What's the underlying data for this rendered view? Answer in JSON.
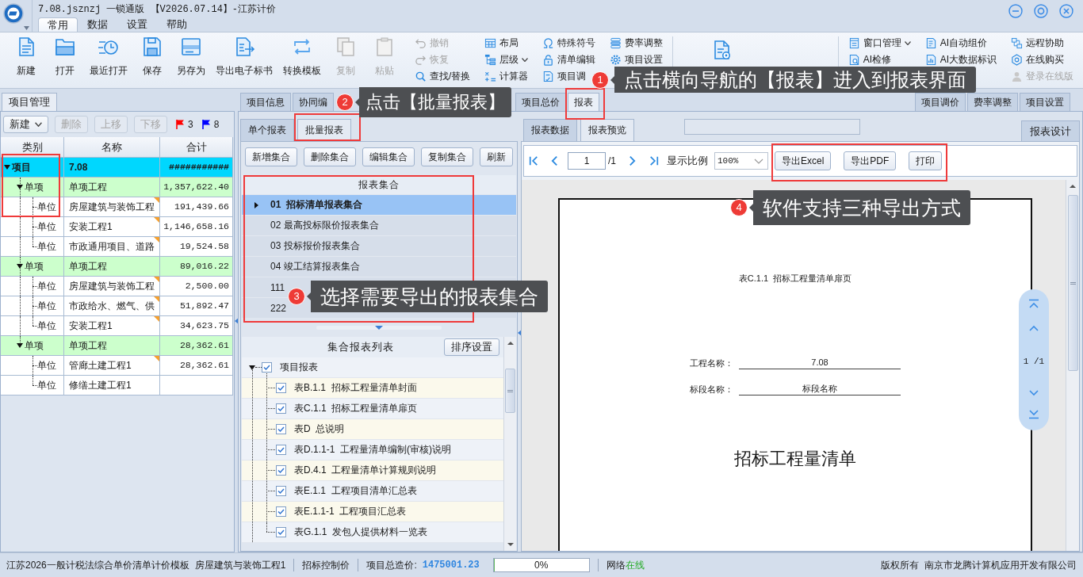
{
  "window": {
    "title": "7.08.jsznzj 一锁通版 【V2026.07.14】-江苏计价"
  },
  "menu_tabs": [
    {
      "label": "常用",
      "selected": true
    },
    {
      "label": "数据",
      "selected": false
    },
    {
      "label": "设置",
      "selected": false
    },
    {
      "label": "帮助",
      "selected": false
    }
  ],
  "toolbar": {
    "large_buttons": [
      {
        "label": "新建",
        "disabled": false
      },
      {
        "label": "打开",
        "disabled": false
      },
      {
        "label": "最近打开",
        "disabled": false
      },
      {
        "label": "保存",
        "disabled": false
      },
      {
        "label": "另存为",
        "disabled": false
      },
      {
        "label": "导出电子标书",
        "disabled": false
      },
      {
        "label": "转换模板",
        "disabled": false
      },
      {
        "label": "复制",
        "disabled": true
      },
      {
        "label": "粘贴",
        "disabled": true
      }
    ],
    "small_columns": [
      [
        {
          "label": "撤销",
          "kind": "button",
          "disabled": true
        },
        {
          "label": "恢复",
          "kind": "button",
          "disabled": true
        },
        {
          "label": "查找/替换",
          "kind": "button",
          "disabled": false
        }
      ],
      [
        {
          "label": "布局",
          "kind": "button",
          "disabled": false
        },
        {
          "label": "层级",
          "kind": "dropdown",
          "disabled": false
        },
        {
          "label": "计算器",
          "kind": "button",
          "disabled": false
        }
      ],
      [
        {
          "label": "特殊符号",
          "kind": "button",
          "disabled": false
        },
        {
          "label": "清单编辑",
          "kind": "button",
          "disabled": false
        },
        {
          "label": "项目调",
          "kind": "button",
          "disabled": false
        }
      ],
      [
        {
          "label": "费率调整",
          "kind": "button",
          "disabled": false
        },
        {
          "label": "项目设置",
          "kind": "button",
          "disabled": false
        }
      ]
    ],
    "right_columns": [
      [
        {
          "label": "窗口管理",
          "kind": "dropdown",
          "disabled": false
        },
        {
          "label": "AI检修",
          "kind": "button",
          "disabled": false
        }
      ],
      [
        {
          "label": "AI自动组价",
          "kind": "button",
          "disabled": false
        },
        {
          "label": "AI大数据标识",
          "kind": "button",
          "disabled": false
        }
      ],
      [
        {
          "label": "远程协助",
          "kind": "button",
          "disabled": false
        },
        {
          "label": "在线购买",
          "kind": "button",
          "disabled": false
        },
        {
          "label": "登录在线版",
          "kind": "button",
          "disabled": true
        }
      ]
    ]
  },
  "project_panel": {
    "tab": "项目管理",
    "actions": [
      {
        "label": "新建",
        "kind": "dropdown",
        "disabled": false
      },
      {
        "label": "删除",
        "kind": "button",
        "disabled": true
      },
      {
        "label": "上移",
        "kind": "button",
        "disabled": true
      },
      {
        "label": "下移",
        "kind": "button",
        "disabled": true
      }
    ],
    "flags": [
      {
        "count": "3",
        "color": "#ff0000"
      },
      {
        "count": "8",
        "color": "#0000ff"
      }
    ],
    "columns": [
      "类别",
      "名称",
      "合计"
    ],
    "tree": [
      {
        "category": "项目",
        "name": "7.08",
        "total": "###########",
        "kind": "project",
        "expanded": true,
        "marked": false,
        "children": [
          {
            "category": "单项",
            "name": "单项工程",
            "total": "1,357,622.40",
            "kind": "group",
            "expanded": true,
            "marked": false,
            "children": [
              {
                "category": "单位",
                "name": "房屋建筑与装饰工程",
                "total": "191,439.66",
                "kind": "unit",
                "marked": true
              },
              {
                "category": "单位",
                "name": "安装工程1",
                "total": "1,146,658.16",
                "kind": "unit",
                "marked": true
              },
              {
                "category": "单位",
                "name": "市政通用项目、道路",
                "total": "19,524.58",
                "kind": "unit",
                "marked": true
              }
            ]
          },
          {
            "category": "单项",
            "name": "单项工程",
            "total": "89,016.22",
            "kind": "group",
            "expanded": true,
            "marked": false,
            "children": [
              {
                "category": "单位",
                "name": "房屋建筑与装饰工程",
                "total": "2,500.00",
                "kind": "unit",
                "marked": true
              },
              {
                "category": "单位",
                "name": "市政给水、燃气、供",
                "total": "51,892.47",
                "kind": "unit",
                "marked": true
              },
              {
                "category": "单位",
                "name": "安装工程1",
                "total": "34,623.75",
                "kind": "unit",
                "marked": true
              }
            ]
          },
          {
            "category": "单项",
            "name": "单项工程",
            "total": "28,362.61",
            "kind": "group",
            "expanded": true,
            "marked": false,
            "children": [
              {
                "category": "单位",
                "name": "管廊土建工程1",
                "total": "28,362.61",
                "kind": "unit",
                "marked": true
              },
              {
                "category": "单位",
                "name": "修缮土建工程1",
                "kind": "unit",
                "marked": false
              }
            ]
          }
        ]
      }
    ]
  },
  "main_tabs": {
    "left": [
      {
        "label": "项目信息",
        "selected": false
      },
      {
        "label": "协同编",
        "selected": false
      },
      {
        "label": "项目总价",
        "selected": false
      },
      {
        "label": "报表",
        "selected": true
      }
    ],
    "right": [
      {
        "label": "项目调价",
        "selected": false
      },
      {
        "label": "费率调整",
        "selected": false
      },
      {
        "label": "项目设置",
        "selected": false
      }
    ]
  },
  "report_panel": {
    "sub_tabs": [
      {
        "label": "单个报表",
        "selected": false
      },
      {
        "label": "批量报表",
        "selected": true
      }
    ],
    "actions": [
      "新增集合",
      "删除集合",
      "编辑集合",
      "复制集合",
      "刷新"
    ],
    "collections": {
      "header": "报表集合",
      "rows": [
        {
          "label": "01  招标清单报表集合",
          "selected": true
        },
        {
          "label": "02 最高投标限价报表集合",
          "selected": false
        },
        {
          "label": "03 投标报价报表集合",
          "selected": false
        },
        {
          "label": "04 竣工结算报表集合",
          "selected": false
        },
        {
          "label": "111",
          "selected": false
        },
        {
          "label": "222",
          "selected": false
        }
      ]
    },
    "report_list": {
      "header": "集合报表列表",
      "sort_button": "排序设置",
      "tree": {
        "label": "项目报表",
        "checked": true,
        "expanded": true,
        "children": [
          {
            "label": "表B.1.1  招标工程量清单封面",
            "checked": true
          },
          {
            "label": "表C.1.1  招标工程量清单扉页",
            "checked": true
          },
          {
            "label": "表D  总说明",
            "checked": true
          },
          {
            "label": "表D.1.1-1  工程量清单编制(审核)说明",
            "checked": true
          },
          {
            "label": "表D.4.1  工程量清单计算规则说明",
            "checked": true
          },
          {
            "label": "表E.1.1  工程项目清单汇总表",
            "checked": true
          },
          {
            "label": "表E.1.1-1  工程项目汇总表",
            "checked": true
          },
          {
            "label": "表G.1.1  发包人提供材料一览表",
            "checked": true
          }
        ]
      }
    }
  },
  "preview": {
    "sub_tabs": [
      {
        "label": "报表数据",
        "selected": false
      },
      {
        "label": "报表预览",
        "selected": true
      }
    ],
    "design_button": "报表设计",
    "page_number": "1",
    "page_total": "/1",
    "zoom_label": "显示比例",
    "zoom": "100%",
    "export_buttons": [
      "导出Excel",
      "导出PDF",
      "打印"
    ],
    "page": {
      "caption": "表C.1.1  招标工程量清单扉页",
      "fields": [
        {
          "label": "工程名称：",
          "value": "7.08"
        },
        {
          "label": "标段名称：",
          "value": "标段名称"
        }
      ],
      "title": "招标工程量清单"
    },
    "page_indicator": "1 /1"
  },
  "status_bar": {
    "template": "江苏2026一般计税法综合单价清单计价模板",
    "unit": "房屋建筑与装饰工程1",
    "mode": "招标控制价",
    "total_label": "项目总造价:",
    "total": "1475001.23",
    "progress": {
      "level": 0,
      "reading": "0%"
    },
    "network_label": "网络",
    "network_state": "在线",
    "copyright": "版权所有",
    "company": "南京市龙腾计算机应用开发有限公司"
  },
  "annotations": [
    {
      "number": "1",
      "text": "点击横向导航的【报表】进入到报表界面"
    },
    {
      "number": "2",
      "text": "点击【批量报表】"
    },
    {
      "number": "3",
      "text": "选择需要导出的报表集合"
    },
    {
      "number": "4",
      "text": "软件支持三种导出方式"
    }
  ]
}
